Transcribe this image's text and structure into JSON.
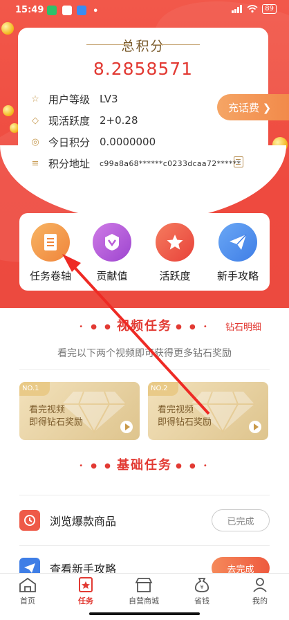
{
  "status_bar": {
    "time": "15:49",
    "battery": "89",
    "dot": "•"
  },
  "points_card": {
    "title": "总积分",
    "total": "8.2858571",
    "rows": [
      {
        "label": "用户等级",
        "value": "LV3",
        "icon": "star-icon"
      },
      {
        "label": "现活跃度",
        "value": "2+0.28",
        "icon": "diamond-icon"
      },
      {
        "label": "今日积分",
        "value": "0.0000000",
        "icon": "medal-icon"
      },
      {
        "label": "积分地址",
        "value": "c99a8a68******c0233dcaa72******",
        "icon": "menu-icon"
      }
    ]
  },
  "recharge": {
    "label": "充话费 ❯"
  },
  "entries": [
    {
      "label": "任务卷轴",
      "icon": "scroll-icon",
      "color": "#f39a4c"
    },
    {
      "label": "贡献值",
      "icon": "badge-icon",
      "color": "#b95ed8"
    },
    {
      "label": "活跃度",
      "icon": "star-icon",
      "color": "#f0533f"
    },
    {
      "label": "新手攻略",
      "icon": "paper-plane-icon",
      "color": "#4a8ef0"
    }
  ],
  "video_section": {
    "title": "视频任务",
    "link": "钻石明细",
    "tip": "看完以下两个视频即可获得更多钻石奖励",
    "cards": [
      {
        "no": "NO.1",
        "line1": "看完视频",
        "line2": "即得钻石奖励"
      },
      {
        "no": "NO.2",
        "line1": "看完视频",
        "line2": "即得钻石奖励"
      }
    ]
  },
  "basic_section": {
    "title": "基础任务",
    "tasks": [
      {
        "name": "浏览爆款商品",
        "button": "已完成",
        "icon": "clock-icon"
      },
      {
        "name": "查看新手攻略",
        "button": "去完成",
        "icon": "paper-plane-icon"
      }
    ]
  },
  "bottom_nav": [
    {
      "label": "首页",
      "icon": "home-icon",
      "active": false
    },
    {
      "label": "任务",
      "icon": "task-icon",
      "active": true
    },
    {
      "label": "自营商城",
      "icon": "store-icon",
      "active": false
    },
    {
      "label": "省钱",
      "icon": "money-bag-icon",
      "active": false
    },
    {
      "label": "我的",
      "icon": "user-icon",
      "active": false
    }
  ],
  "colors": {
    "accent": "#e23a33",
    "hero": "#ef4d41",
    "gold": "#c79b52",
    "orange": "#f28a4a"
  }
}
